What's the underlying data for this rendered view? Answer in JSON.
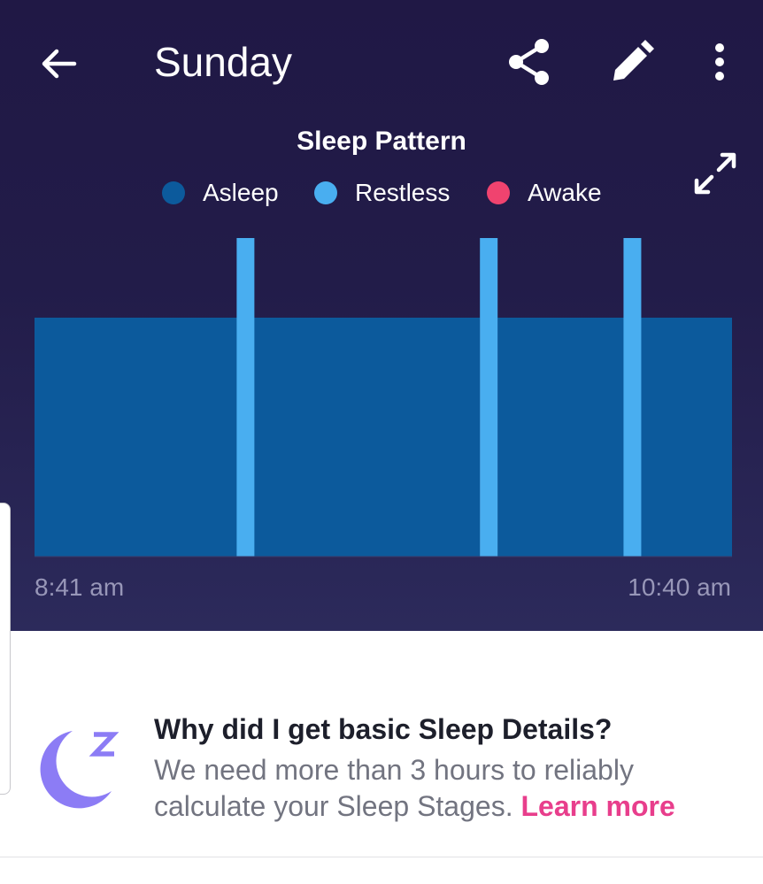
{
  "header": {
    "title": "Sunday",
    "back_icon": "arrow-left-icon",
    "share_icon": "share-icon",
    "edit_icon": "pencil-icon",
    "more_icon": "more-vert-icon"
  },
  "chart_section": {
    "expand_icon": "expand-icon",
    "start_time": "8:41 am",
    "end_time": "10:40 am"
  },
  "chart_data": {
    "type": "area",
    "title": "Sleep Pattern",
    "legend": [
      {
        "name": "Asleep",
        "color": "#0c5a9c"
      },
      {
        "name": "Restless",
        "color": "#49aef0"
      },
      {
        "name": "Awake",
        "color": "#f0436f"
      }
    ],
    "legend_position": "top",
    "x_range": [
      "8:41 am",
      "10:40 am"
    ],
    "levels": [
      "Asleep",
      "Restless",
      "Awake"
    ],
    "segments": [
      {
        "start": "8:41 am",
        "end": "9:16 am",
        "state": "Asleep"
      },
      {
        "start": "9:16 am",
        "end": "9:18 am",
        "state": "Restless"
      },
      {
        "start": "9:18 am",
        "end": "9:57 am",
        "state": "Asleep"
      },
      {
        "start": "9:57 am",
        "end": "10:00 am",
        "state": "Restless"
      },
      {
        "start": "10:00 am",
        "end": "10:22 am",
        "state": "Asleep"
      },
      {
        "start": "10:22 am",
        "end": "10:24 am",
        "state": "Restless"
      },
      {
        "start": "10:24 am",
        "end": "10:40 am",
        "state": "Asleep"
      }
    ],
    "grid": false
  },
  "info": {
    "icon": "sleep-moon-icon",
    "title": "Why did I get basic Sleep Details?",
    "body": "We need more than 3 hours to reliably calculate your Sleep Stages.",
    "link": "Learn more"
  },
  "colors": {
    "background_top": "#201845",
    "asleep": "#0c5a9c",
    "restless": "#49aef0",
    "awake": "#f0436f",
    "link": "#e83e8c",
    "moon": "#8c7cf5"
  }
}
